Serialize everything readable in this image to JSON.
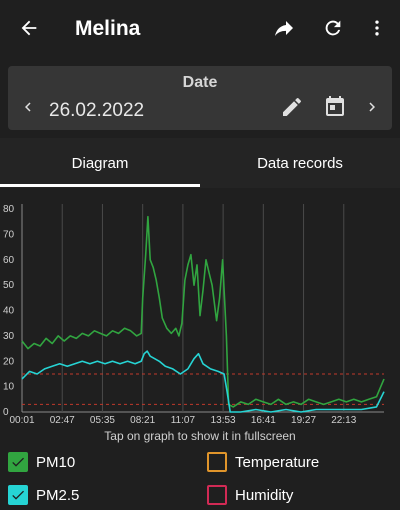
{
  "app_bar": {
    "title": "Melina",
    "back_icon": "arrow-left-icon",
    "share_icon": "share-arrow-icon",
    "refresh_icon": "refresh-icon",
    "menu_icon": "more-vertical-icon"
  },
  "date_picker": {
    "caption": "Date",
    "value": "26.02.2022",
    "prev_icon": "chevron-left-icon",
    "edit_icon": "pencil-icon",
    "calendar_icon": "calendar-icon",
    "next_icon": "chevron-right-icon"
  },
  "tabs": [
    {
      "label": "Diagram",
      "active": true
    },
    {
      "label": "Data records",
      "active": false
    }
  ],
  "chart_hint": "Tap on graph to show it in fullscreen",
  "chart_data": {
    "type": "line",
    "x_tick_labels": [
      "00:01",
      "02:47",
      "05:35",
      "08:21",
      "11:07",
      "13:53",
      "16:41",
      "19:27",
      "22:13"
    ],
    "y_tick_labels": [
      "0",
      "10",
      "20",
      "30",
      "40",
      "50",
      "60",
      "70",
      "80"
    ],
    "ylim": [
      0,
      82
    ],
    "x_unit_hours": [
      0.0,
      24.0
    ],
    "grid": "vertical",
    "threshold_lines": [
      15,
      3
    ],
    "series": [
      {
        "name": "PM10",
        "color": "#31a540",
        "points": [
          [
            0.0,
            28
          ],
          [
            0.4,
            25
          ],
          [
            0.8,
            27
          ],
          [
            1.2,
            26
          ],
          [
            1.6,
            29
          ],
          [
            2.0,
            27
          ],
          [
            2.4,
            30
          ],
          [
            2.8,
            28
          ],
          [
            3.2,
            30
          ],
          [
            3.6,
            29
          ],
          [
            4.0,
            31
          ],
          [
            4.4,
            30
          ],
          [
            4.8,
            32
          ],
          [
            5.2,
            31
          ],
          [
            5.6,
            30
          ],
          [
            6.0,
            32
          ],
          [
            6.4,
            31
          ],
          [
            6.8,
            33
          ],
          [
            7.2,
            32
          ],
          [
            7.6,
            30
          ],
          [
            7.9,
            31
          ],
          [
            8.0,
            45
          ],
          [
            8.2,
            62
          ],
          [
            8.35,
            77
          ],
          [
            8.5,
            60
          ],
          [
            8.7,
            57
          ],
          [
            8.9,
            52
          ],
          [
            9.1,
            45
          ],
          [
            9.3,
            37
          ],
          [
            9.6,
            33
          ],
          [
            9.9,
            31
          ],
          [
            10.2,
            33
          ],
          [
            10.4,
            30
          ],
          [
            10.6,
            35
          ],
          [
            10.8,
            52
          ],
          [
            11.0,
            58
          ],
          [
            11.2,
            62
          ],
          [
            11.4,
            50
          ],
          [
            11.6,
            58
          ],
          [
            11.8,
            38
          ],
          [
            12.0,
            48
          ],
          [
            12.2,
            60
          ],
          [
            12.4,
            55
          ],
          [
            12.6,
            50
          ],
          [
            12.9,
            36
          ],
          [
            13.1,
            45
          ],
          [
            13.3,
            60
          ],
          [
            13.55,
            30
          ],
          [
            13.7,
            3
          ],
          [
            14.0,
            2
          ],
          [
            14.5,
            4
          ],
          [
            15.0,
            3
          ],
          [
            15.5,
            5
          ],
          [
            16.0,
            4
          ],
          [
            16.5,
            3
          ],
          [
            17.0,
            5
          ],
          [
            17.5,
            3
          ],
          [
            18.0,
            4
          ],
          [
            18.5,
            3
          ],
          [
            19.0,
            5
          ],
          [
            19.5,
            4
          ],
          [
            20.0,
            3
          ],
          [
            20.5,
            4
          ],
          [
            21.0,
            5
          ],
          [
            21.5,
            4
          ],
          [
            22.0,
            5
          ],
          [
            22.5,
            4
          ],
          [
            23.0,
            5
          ],
          [
            23.5,
            6
          ],
          [
            24.0,
            13
          ]
        ]
      },
      {
        "name": "PM2.5",
        "color": "#26d4d4",
        "points": [
          [
            0.0,
            13
          ],
          [
            0.5,
            16
          ],
          [
            1.0,
            15
          ],
          [
            1.5,
            17
          ],
          [
            2.0,
            18
          ],
          [
            2.5,
            19
          ],
          [
            3.0,
            18
          ],
          [
            3.5,
            19
          ],
          [
            4.0,
            20
          ],
          [
            4.5,
            19
          ],
          [
            5.0,
            20
          ],
          [
            5.5,
            19
          ],
          [
            6.0,
            20
          ],
          [
            6.5,
            19
          ],
          [
            7.0,
            20
          ],
          [
            7.5,
            19
          ],
          [
            7.9,
            20
          ],
          [
            8.1,
            23
          ],
          [
            8.3,
            24
          ],
          [
            8.5,
            22
          ],
          [
            8.8,
            21
          ],
          [
            9.1,
            20
          ],
          [
            9.5,
            18
          ],
          [
            10.0,
            17
          ],
          [
            10.5,
            15
          ],
          [
            11.0,
            17
          ],
          [
            11.4,
            21
          ],
          [
            11.7,
            23
          ],
          [
            12.0,
            19
          ],
          [
            12.5,
            17
          ],
          [
            13.0,
            16
          ],
          [
            13.4,
            15
          ],
          [
            13.6,
            8
          ],
          [
            13.8,
            0
          ],
          [
            14.5,
            0
          ],
          [
            15.5,
            1
          ],
          [
            16.5,
            0
          ],
          [
            17.5,
            1
          ],
          [
            18.5,
            0
          ],
          [
            19.5,
            1
          ],
          [
            20.5,
            1
          ],
          [
            21.5,
            1
          ],
          [
            22.5,
            1
          ],
          [
            23.5,
            2
          ],
          [
            24.0,
            8
          ]
        ]
      }
    ]
  },
  "legend": [
    {
      "label": "PM10",
      "checked": true,
      "color": "#31a540"
    },
    {
      "label": "Temperature",
      "checked": false,
      "color": "#e0952b"
    },
    {
      "label": "PM2.5",
      "checked": true,
      "color": "#26d4d4"
    },
    {
      "label": "Humidity",
      "checked": false,
      "color": "#d22a55"
    }
  ]
}
